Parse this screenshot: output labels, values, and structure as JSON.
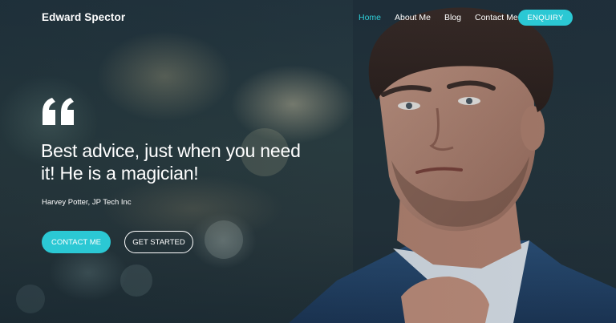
{
  "header": {
    "brand": "Edward Spector",
    "nav": [
      {
        "label": "Home",
        "active": true
      },
      {
        "label": "About Me",
        "active": false
      },
      {
        "label": "Blog",
        "active": false
      },
      {
        "label": "Contact Me",
        "active": false
      }
    ],
    "enquiry_label": "ENQUIRY"
  },
  "hero": {
    "quote_icon": "quote-icon",
    "headline": "Best advice, just when you need it! He is a magician!",
    "attribution": "Harvey Potter, JP Tech Inc",
    "contact_label": "CONTACT ME",
    "get_started_label": "GET STARTED"
  },
  "colors": {
    "accent": "#2bc8d4",
    "active_nav": "#2fd0d9",
    "text": "#ffffff"
  }
}
